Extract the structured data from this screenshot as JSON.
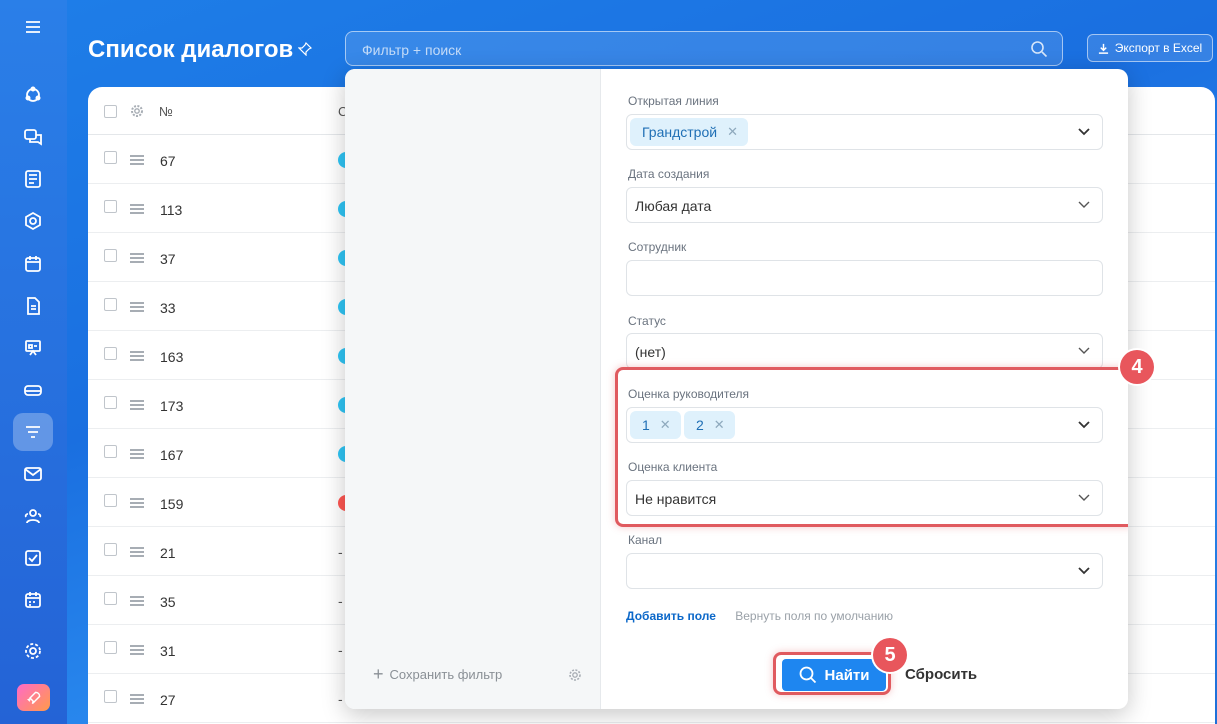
{
  "header": {
    "title": "Список диалогов",
    "search_placeholder": "Фильтр + поиск",
    "export_label": "Экспорт в Excel"
  },
  "list": {
    "col_number": "№",
    "col_c": "С",
    "rows": [
      {
        "num": "67",
        "marker": "dot"
      },
      {
        "num": "113",
        "marker": "dot"
      },
      {
        "num": "37",
        "marker": "dot"
      },
      {
        "num": "33",
        "marker": "dot"
      },
      {
        "num": "163",
        "marker": "dot"
      },
      {
        "num": "173",
        "marker": "dot"
      },
      {
        "num": "167",
        "marker": "dot"
      },
      {
        "num": "159",
        "marker": "red"
      },
      {
        "num": "21",
        "marker": "-"
      },
      {
        "num": "35",
        "marker": "-"
      },
      {
        "num": "31",
        "marker": "-"
      },
      {
        "num": "27",
        "marker": "-"
      }
    ]
  },
  "filter": {
    "fields": {
      "open_line": {
        "label": "Открытая линия",
        "tags": [
          "Грандстрой"
        ]
      },
      "created": {
        "label": "Дата создания",
        "value": "Любая дата"
      },
      "employee": {
        "label": "Сотрудник",
        "value": ""
      },
      "status": {
        "label": "Статус",
        "value": "(нет)"
      },
      "manager_rating": {
        "label": "Оценка руководителя",
        "tags": [
          "1",
          "2"
        ]
      },
      "client_rating": {
        "label": "Оценка клиента",
        "value": "Не нравится"
      },
      "channel": {
        "label": "Канал",
        "value": ""
      }
    },
    "add_field": "Добавить поле",
    "restore_fields": "Вернуть поля по умолчанию",
    "save_filter": "Сохранить фильтр",
    "find_button": "Найти",
    "reset_button": "Сбросить",
    "step_badges": [
      "4",
      "5"
    ]
  },
  "colors": {
    "accent": "#1e86f0",
    "highlight": "#e05a5f",
    "tag_bg": "#dff1fc"
  },
  "icons": [
    "menu-icon",
    "automation-icon",
    "chats-icon",
    "news-icon",
    "hexagon-icon",
    "calendar-icon",
    "document-icon",
    "presentation-icon",
    "storage-icon",
    "filter-icon",
    "mail-icon",
    "users-icon",
    "tasks-icon",
    "planner-icon",
    "settings-icon",
    "rocket-icon"
  ]
}
